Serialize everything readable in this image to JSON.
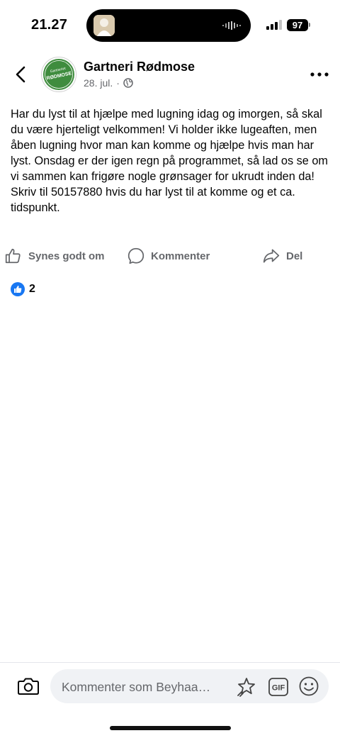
{
  "status_bar": {
    "time": "21.27",
    "battery": "97"
  },
  "post": {
    "page_name": "Gartneri Rødmose",
    "logo_text_top": "Gartneriet",
    "logo_text_main": "RØDMOSE",
    "date": "28. jul.",
    "separator": "·",
    "text": "Har du lyst til at hjælpe med lugning idag og imorgen, så skal du være hjerteligt velkommen! Vi holder ikke lugeaften, men åben lugning hvor man kan komme og hjælpe hvis man har lyst. Onsdag er der igen regn på programmet, så lad os se om vi sammen kan frigøre nogle grønsager for ukrudt inden da!\nSkriv til 50157880 hvis du har lyst til at komme og et ca. tidspunkt."
  },
  "actions": {
    "like": "Synes godt om",
    "comment": "Kommenter",
    "share": "Del"
  },
  "reactions": {
    "count": "2"
  },
  "comment_bar": {
    "placeholder": "Kommenter som Beyhaa…",
    "gif": "GIF"
  },
  "colors": {
    "brand_blue": "#1877f2",
    "muted": "#65676b",
    "logo_green": "#3f8c3e"
  }
}
